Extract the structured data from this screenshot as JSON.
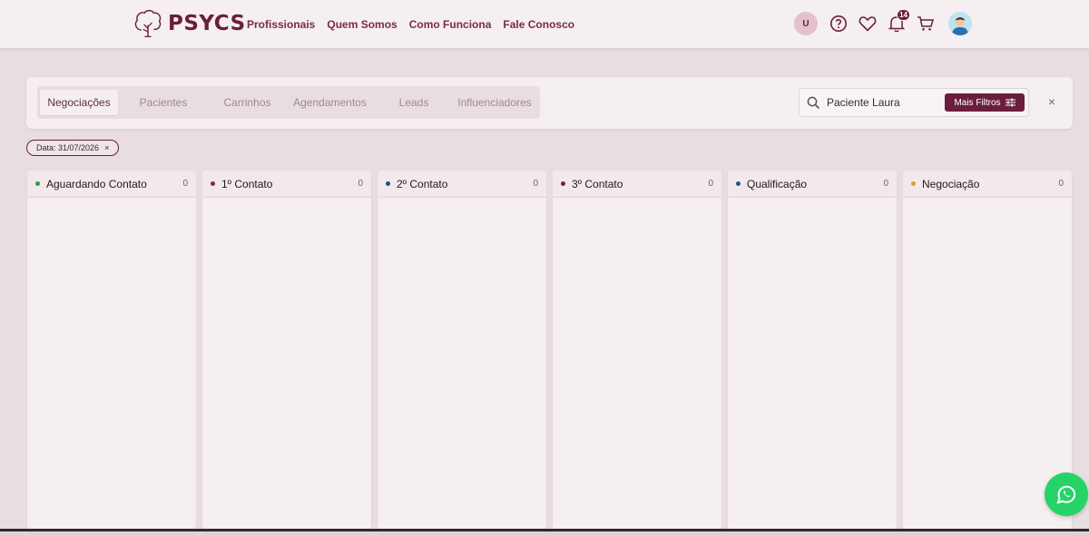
{
  "brand": {
    "name": "PSYCS",
    "color": "#6b1e3c"
  },
  "nav": [
    {
      "label": "Profissionais"
    },
    {
      "label": "Quem Somos"
    },
    {
      "label": "Como Funciona"
    },
    {
      "label": "Fale Conosco"
    }
  ],
  "header_icons": {
    "user_initial": "U",
    "help_icon": "question-circle-icon",
    "favorites_icon": "heart-icon",
    "notifications_icon": "bell-icon",
    "notifications_count": "14",
    "cart_icon": "cart-icon",
    "profile_icon": "user-avatar-icon"
  },
  "tabs": [
    {
      "label": "Negociações",
      "active": true
    },
    {
      "label": "Pacientes",
      "active": false
    },
    {
      "label": "Carrinhos",
      "active": false
    },
    {
      "label": "Agendamentos",
      "active": false
    },
    {
      "label": "Leads",
      "active": false
    },
    {
      "label": "Influenciadores",
      "active": false
    }
  ],
  "search": {
    "value": "Paciente Laura",
    "more_filters_label": "Mais Filtros"
  },
  "filter_chip": {
    "label": "Data: 31/07/2026",
    "remove": "×"
  },
  "close_label": "×",
  "columns": [
    {
      "title": "Aguardando Contato",
      "count": "0",
      "color": "#2e9c4a"
    },
    {
      "title": "1º Contato",
      "count": "0",
      "color": "#8a2747"
    },
    {
      "title": "2º Contato",
      "count": "0",
      "color": "#1f4f6b"
    },
    {
      "title": "3º Contato",
      "count": "0",
      "color": "#7a1f36"
    },
    {
      "title": "Qualificação",
      "count": "0",
      "color": "#1f5b7a"
    },
    {
      "title": "Negociação",
      "count": "0",
      "color": "#e89a2c"
    }
  ],
  "whatsapp_icon": "whatsapp-icon"
}
